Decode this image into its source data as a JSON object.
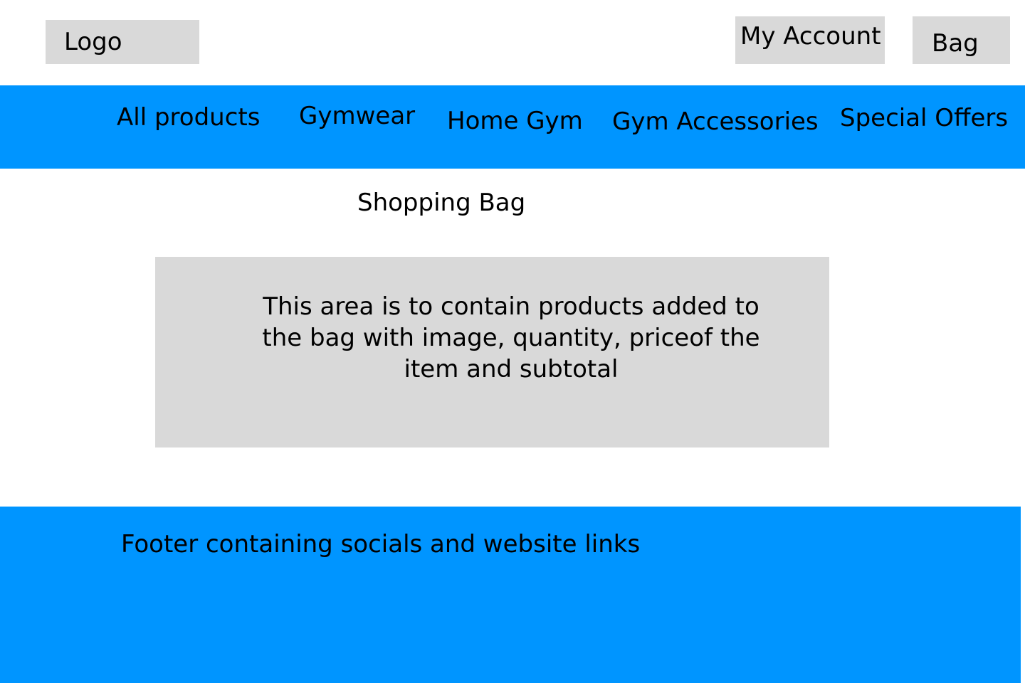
{
  "header": {
    "logo_label": "Logo",
    "account_label": "My Account",
    "bag_label": "Bag"
  },
  "nav": {
    "items": [
      {
        "label": "All products"
      },
      {
        "label": "Gymwear"
      },
      {
        "label": "Home Gym"
      },
      {
        "label": "Gym Accessories"
      },
      {
        "label": "Special Offers"
      }
    ]
  },
  "main": {
    "title": "Shopping Bag",
    "bag_placeholder": "This area is to contain products added to the bag with image, quantity, priceof the item and subtotal"
  },
  "footer": {
    "text": "Footer containing socials and website links"
  },
  "colors": {
    "brand_blue": "#0095ff",
    "placeholder_gray": "#d9d9d9"
  }
}
